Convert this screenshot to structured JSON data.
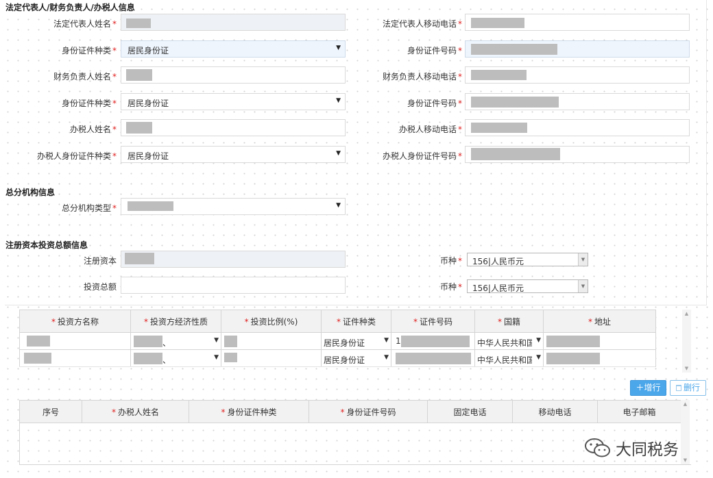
{
  "sections": {
    "legal": "法定代表人/财务负责人/办税人信息",
    "branch": "总分机构信息",
    "capital": "注册资本投资总额信息"
  },
  "legal": {
    "rep_name_label": "法定代表人姓名",
    "rep_phone_label": "法定代表人移动电话",
    "rep_id_type_label": "身份证件种类",
    "rep_id_type_value": "居民身份证",
    "rep_id_no_label": "身份证件号码",
    "fin_name_label": "财务负责人姓名",
    "fin_phone_label": "财务负责人移动电话",
    "fin_id_type_label": "身份证件种类",
    "fin_id_type_value": "居民身份证",
    "fin_id_no_label": "身份证件号码",
    "tax_name_label": "办税人姓名",
    "tax_phone_label": "办税人移动电话",
    "tax_id_type_label": "办税人身份证件种类",
    "tax_id_type_value": "居民身份证",
    "tax_id_no_label": "办税人身份证件号码"
  },
  "branch": {
    "type_label": "总分机构类型"
  },
  "capital": {
    "registered_label": "注册资本",
    "total_label": "投资总额",
    "currency_label": "币种",
    "currency1_value": "156|人民币元",
    "currency2_value": "156|人民币元"
  },
  "required_mark": "*",
  "investor_table": {
    "headers": [
      "投资方名称",
      "投资方经济性质",
      "投资比例(%)",
      "证件种类",
      "证件号码",
      "国籍",
      "地址"
    ],
    "rows": [
      {
        "id_type": "居民身份证",
        "nationality": "中华人民共和国",
        "economic_suffix": "、",
        "id_prefix": "1"
      },
      {
        "id_type": "居民身份证",
        "nationality": "中华人民共和国",
        "economic_suffix": "、",
        "id_prefix": ""
      }
    ]
  },
  "toolbar": {
    "add_label": "增行",
    "delete_label": "删行"
  },
  "agent_table": {
    "headers": [
      {
        "label": "序号",
        "required": false
      },
      {
        "label": "办税人姓名",
        "required": true
      },
      {
        "label": "身份证件种类",
        "required": true
      },
      {
        "label": "身份证件号码",
        "required": true
      },
      {
        "label": "固定电话",
        "required": false
      },
      {
        "label": "移动电话",
        "required": false
      },
      {
        "label": "电子邮箱",
        "required": false
      }
    ]
  },
  "watermark": {
    "text": "大同税务",
    "icon": "wechat-icon"
  },
  "colors": {
    "required": "#e02020",
    "accent": "#4ba6ea",
    "readonly_bg": "#eef1f5"
  }
}
